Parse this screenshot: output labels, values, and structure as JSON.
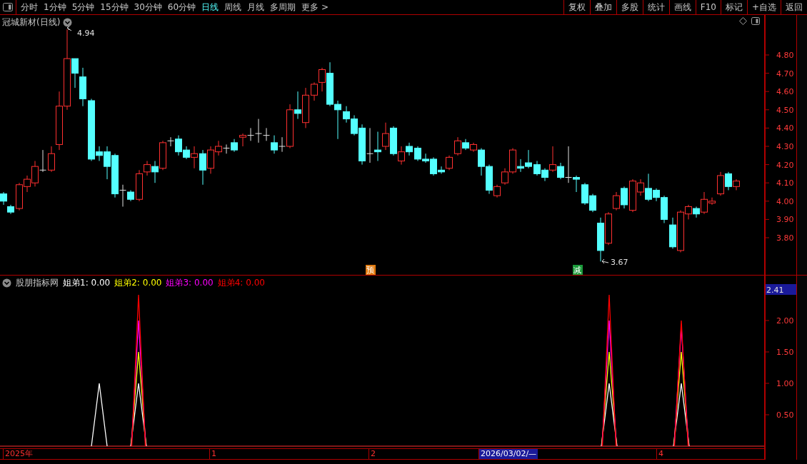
{
  "toolbar": {
    "tabs": [
      {
        "label": "分时",
        "selected": false
      },
      {
        "label": "1分钟",
        "selected": false
      },
      {
        "label": "5分钟",
        "selected": false
      },
      {
        "label": "15分钟",
        "selected": false
      },
      {
        "label": "30分钟",
        "selected": false
      },
      {
        "label": "60分钟",
        "selected": false
      },
      {
        "label": "日线",
        "selected": true
      },
      {
        "label": "周线",
        "selected": false
      },
      {
        "label": "月线",
        "selected": false
      },
      {
        "label": "多周期",
        "selected": false
      },
      {
        "label": "更多 >",
        "selected": false
      }
    ],
    "buttons": [
      "复权",
      "叠加",
      "多股",
      "统计",
      "画线",
      "F10",
      "标记",
      "+自选",
      "返回"
    ]
  },
  "price_chart": {
    "title": "冠城新材(日线)",
    "high_label": "4.94",
    "low_label": "3.67",
    "signals": [
      {
        "text": "预",
        "color": "#e07a10"
      },
      {
        "text": "减",
        "color": "#1a9a3a"
      }
    ],
    "axis_labels": [
      "4.80",
      "4.70",
      "4.60",
      "4.50",
      "4.40",
      "4.30",
      "4.20",
      "4.10",
      "4.00",
      "3.90",
      "3.80"
    ]
  },
  "indicator": {
    "name": "股朋指标网",
    "legend": [
      {
        "label": "姐弟1:",
        "value": "0.00",
        "color": "#ffffff"
      },
      {
        "label": "姐弟2:",
        "value": "0.00",
        "color": "#ffff00"
      },
      {
        "label": "姐弟3:",
        "value": "0.00",
        "color": "#ff00ff"
      },
      {
        "label": "姐弟4:",
        "value": "0.00",
        "color": "#ff0000"
      }
    ],
    "current_value": "2.41",
    "axis_labels": [
      "2.00",
      "1.50",
      "1.00",
      "0.50"
    ]
  },
  "time_axis": [
    {
      "text": "2025年",
      "selected": false
    },
    {
      "text": "1",
      "selected": false
    },
    {
      "text": "2",
      "selected": false
    },
    {
      "text": "2026/03/02/—",
      "selected": true
    },
    {
      "text": "4",
      "selected": false
    }
  ]
}
